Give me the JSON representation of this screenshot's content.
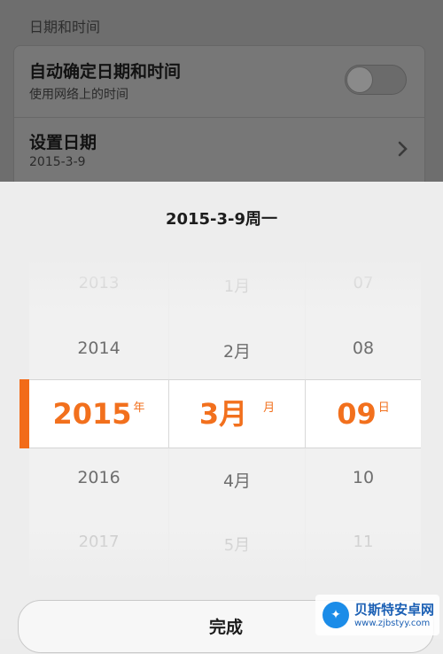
{
  "background": {
    "section_header": "日期和时间",
    "auto_row": {
      "title": "自动确定日期和时间",
      "subtitle": "使用网络上的时间",
      "toggle_on": false
    },
    "date_row": {
      "title": "设置日期",
      "subtitle": "2015-3-9"
    }
  },
  "picker": {
    "title": "2015-3-9周一",
    "year_column": {
      "items": [
        "2013",
        "2014",
        "2015",
        "2016",
        "2017"
      ],
      "selected_index": 2,
      "unit": "年"
    },
    "month_column": {
      "items": [
        "1月",
        "2月",
        "3月",
        "4月",
        "5月"
      ],
      "selected_index": 2,
      "unit": "月"
    },
    "day_column": {
      "items": [
        "07",
        "08",
        "09",
        "10",
        "11"
      ],
      "selected_index": 2,
      "unit": "日"
    },
    "done_label": "完成",
    "accent_color": "#f26b19"
  },
  "watermark": {
    "title": "贝斯特安卓网",
    "url": "www.zjbstyy.com"
  }
}
